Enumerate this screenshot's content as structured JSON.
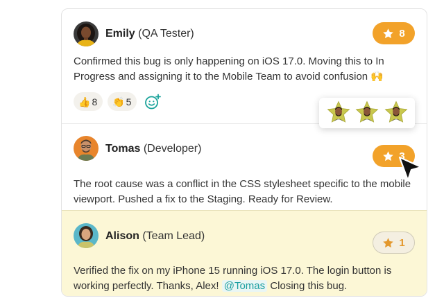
{
  "colors": {
    "accent_orange": "#f2a22a",
    "mention_teal": "#1a9ea0",
    "highlight_yellow": "#fcf7d6"
  },
  "comments": [
    {
      "author": "Emily",
      "role": "(QA Tester)",
      "body": "Confirmed this bug is only happening on iOS 17.0. Moving this to In Progress and assigning it to the Mobile Team to avoid confusion 🙌",
      "star_count": "8",
      "star_state": "filled",
      "reactions": [
        {
          "emoji": "👍",
          "count": "8",
          "icon": "thumbs-up-icon"
        },
        {
          "emoji": "👏",
          "count": "5",
          "icon": "clapping-hands-icon"
        }
      ],
      "add_reaction_icon": "add-emoji-icon"
    },
    {
      "author": "Tomas",
      "role": "(Developer)",
      "body": "The root cause was a conflict in the CSS stylesheet specific to the mobile viewport. Pushed a fix to the Staging. Ready for Review.",
      "star_count": "3",
      "star_state": "filled"
    },
    {
      "author": "Alison",
      "role": "(Team Lead)",
      "body_before": "Verified the fix on my iPhone 15 running iOS 17.0. The login button is working perfectly. Thanks, Alex!",
      "mention": "@Tomas",
      "body_after": "Closing this bug.",
      "star_count": "1",
      "star_state": "outline",
      "highlighted": true
    }
  ],
  "star_popover": {
    "icon": "star-avatar-icon",
    "stargazer_count": 3
  },
  "cursor_icon": "mouse-pointer-icon"
}
